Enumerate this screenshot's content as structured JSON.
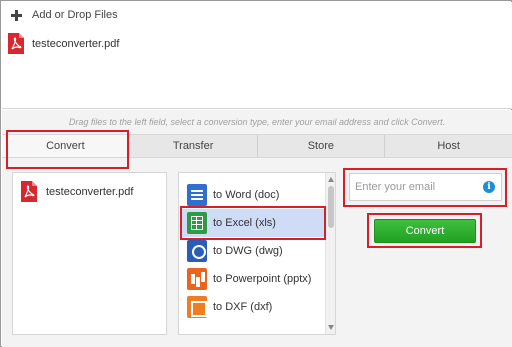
{
  "upload": {
    "add_label": "Add or Drop Files",
    "file_name": "testeconverter.pdf"
  },
  "hint": "Drag files to the left field, select a conversion type, enter your email address and click Convert.",
  "tabs": [
    {
      "label": "Convert",
      "active": true
    },
    {
      "label": "Transfer",
      "active": false
    },
    {
      "label": "Store",
      "active": false
    },
    {
      "label": "Host",
      "active": false
    }
  ],
  "queue": {
    "file_name": "testeconverter.pdf"
  },
  "conversions": [
    {
      "label": "to Word (doc)",
      "icon": "word-icon",
      "selected": false
    },
    {
      "label": "to Excel (xls)",
      "icon": "excel-icon",
      "selected": true
    },
    {
      "label": "to DWG (dwg)",
      "icon": "dwg-icon",
      "selected": false
    },
    {
      "label": "to Powerpoint (pptx)",
      "icon": "powerpoint-icon",
      "selected": false
    },
    {
      "label": "to DXF (dxf)",
      "icon": "dxf-icon",
      "selected": false
    }
  ],
  "email": {
    "placeholder": "Enter your email",
    "value": ""
  },
  "convert_button": "Convert",
  "colors": {
    "highlight": "#d71f2c",
    "convert_green": "#2db32d",
    "selection": "#cfdcf6",
    "pdf_red": "#d7272f"
  }
}
